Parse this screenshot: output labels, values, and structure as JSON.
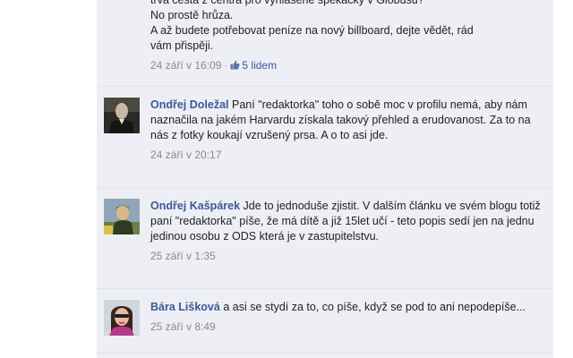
{
  "comments": [
    {
      "lines": [
        "trvá cesta z centra pro vyhlášené špekáčky v Globusu?",
        "No prostě hrůza.",
        "A až budete potřebovat peníze na nový billboard, dejte vědět, rád",
        "vám přispěji."
      ],
      "timestamp": "24 září v 16:09",
      "separator": "·",
      "likes": "5 lidem"
    },
    {
      "author": "Ondřej Doležal",
      "text": "Paní \"redaktorka\" toho o sobě moc v profilu nemá, aby nám naznačila na jakém Harvardu získala takový přehled a erudovanost. Za to na nás z fotky koukají vzrušený prsa. A o to asi jde.",
      "timestamp": "24 září v 20:17"
    },
    {
      "author": "Ondřej Kašpárek",
      "text": "Jde to jednoduše zjistit. V dalším článku ve svém blogu totiž paní \"redaktorka\" píše, že má dítě a již 15let učí - teto popis sedí jen na jednu jedinou osobu z ODS která je v zastupitelstvu.",
      "timestamp": "25 září v 1:35"
    },
    {
      "author": "Bára Lišková",
      "text": "a asi se stydí za to, co píše, když se pod to ani nepodepíše...",
      "timestamp": "25 září v 8:49"
    }
  ],
  "colors": {
    "background": "#edeff4",
    "link": "#3b5998",
    "meta": "#8a8a8a"
  },
  "icons": {
    "like": "thumbs-up-icon"
  }
}
